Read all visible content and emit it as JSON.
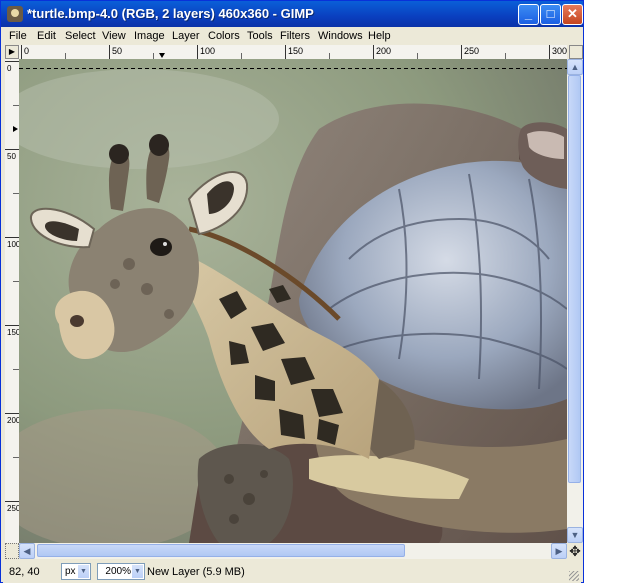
{
  "window": {
    "title": "*turtle.bmp-4.0 (RGB, 2 layers) 460x360 - GIMP",
    "controls": {
      "minimize": "_",
      "maximize": "□",
      "close": "✕"
    }
  },
  "menubar": {
    "items": [
      "File",
      "Edit",
      "Select",
      "View",
      "Image",
      "Layer",
      "Colors",
      "Tools",
      "Filters",
      "Windows",
      "Help"
    ]
  },
  "rulers": {
    "top_labels": [
      "0",
      "50",
      "100",
      "150",
      "200",
      "250",
      "300"
    ],
    "left_labels": [
      "0",
      "50",
      "100",
      "150",
      "200",
      "250"
    ]
  },
  "canvas": {
    "image_name": "turtle.bmp-4.0",
    "description_icons": [
      "giraffe-head-layer",
      "tortoise-photo-layer"
    ]
  },
  "statusbar": {
    "coords": "82, 40",
    "unit": "px",
    "zoom": "200%",
    "layer_info": "New Layer (5.9 MB)"
  },
  "icons": {
    "navigate": "✥",
    "scroll_up": "▲",
    "scroll_down": "▼",
    "scroll_left": "◀",
    "scroll_right": "▶",
    "menu_arrow": "▶"
  },
  "colors": {
    "titlebar": "#0a4fd0",
    "window_bg": "#ece9d8",
    "scroll_thumb": "#b8cdf6"
  }
}
